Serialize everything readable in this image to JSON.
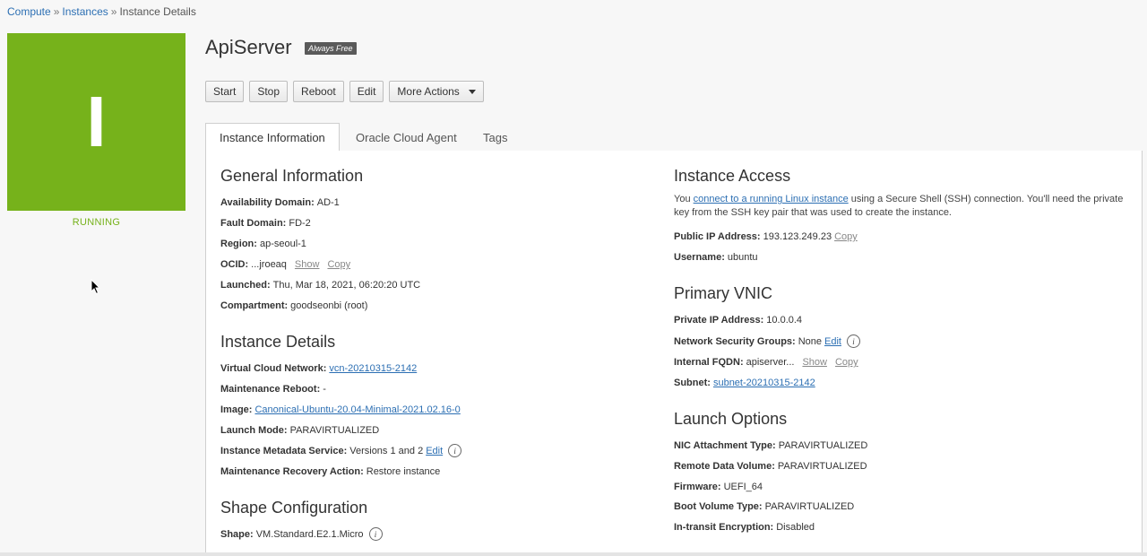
{
  "breadcrumb": {
    "items": [
      "Compute",
      "Instances",
      "Instance Details"
    ],
    "separator": "»"
  },
  "status": {
    "letter": "I",
    "text": "RUNNING",
    "color": "#76b21b"
  },
  "header": {
    "title": "ApiServer",
    "badge": "Always Free"
  },
  "actions": {
    "start": "Start",
    "stop": "Stop",
    "reboot": "Reboot",
    "edit": "Edit",
    "more": "More Actions"
  },
  "tabs": [
    {
      "label": "Instance Information",
      "active": true
    },
    {
      "label": "Oracle Cloud Agent",
      "active": false
    },
    {
      "label": "Tags",
      "active": false
    }
  ],
  "general": {
    "title": "General Information",
    "availability_domain": {
      "label": "Availability Domain:",
      "value": "AD-1"
    },
    "fault_domain": {
      "label": "Fault Domain:",
      "value": "FD-2"
    },
    "region": {
      "label": "Region:",
      "value": "ap-seoul-1"
    },
    "ocid": {
      "label": "OCID:",
      "value": "...jroeaq",
      "show": "Show",
      "copy": "Copy"
    },
    "launched": {
      "label": "Launched:",
      "value": "Thu, Mar 18, 2021, 06:20:20 UTC"
    },
    "compartment": {
      "label": "Compartment:",
      "value": "goodseonbi (root)"
    }
  },
  "instance_details": {
    "title": "Instance Details",
    "vcn": {
      "label": "Virtual Cloud Network:",
      "value": "vcn-20210315-2142"
    },
    "maintenance_reboot": {
      "label": "Maintenance Reboot:",
      "value": "-"
    },
    "image": {
      "label": "Image:",
      "value": "Canonical-Ubuntu-20.04-Minimal-2021.02.16-0"
    },
    "launch_mode": {
      "label": "Launch Mode:",
      "value": "PARAVIRTUALIZED"
    },
    "metadata_service": {
      "label": "Instance Metadata Service:",
      "value": "Versions 1 and 2",
      "edit": "Edit"
    },
    "recovery_action": {
      "label": "Maintenance Recovery Action:",
      "value": "Restore instance"
    }
  },
  "shape": {
    "title": "Shape Configuration",
    "shape": {
      "label": "Shape:",
      "value": "VM.Standard.E2.1.Micro"
    }
  },
  "access": {
    "title": "Instance Access",
    "text_before": "You ",
    "link": "connect to a running Linux instance",
    "text_after": " using a Secure Shell (SSH) connection. You'll need the private key from the SSH key pair that was used to create the instance.",
    "public_ip": {
      "label": "Public IP Address:",
      "value": "193.123.249.23",
      "copy": "Copy"
    },
    "username": {
      "label": "Username:",
      "value": "ubuntu"
    }
  },
  "vnic": {
    "title": "Primary VNIC",
    "private_ip": {
      "label": "Private IP Address:",
      "value": "10.0.0.4"
    },
    "nsg": {
      "label": "Network Security Groups:",
      "value": "None",
      "edit": "Edit"
    },
    "fqdn": {
      "label": "Internal FQDN:",
      "value": "apiserver...",
      "show": "Show",
      "copy": "Copy"
    },
    "subnet": {
      "label": "Subnet:",
      "value": "subnet-20210315-2142"
    }
  },
  "launch": {
    "title": "Launch Options",
    "nic": {
      "label": "NIC Attachment Type:",
      "value": "PARAVIRTUALIZED"
    },
    "remote_volume": {
      "label": "Remote Data Volume:",
      "value": "PARAVIRTUALIZED"
    },
    "firmware": {
      "label": "Firmware:",
      "value": "UEFI_64"
    },
    "boot_volume": {
      "label": "Boot Volume Type:",
      "value": "PARAVIRTUALIZED"
    },
    "encryption": {
      "label": "In-transit Encryption:",
      "value": "Disabled"
    }
  }
}
